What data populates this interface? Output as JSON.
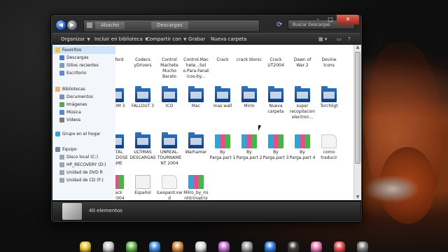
{
  "window": {
    "address_segments": [
      "Abacho",
      "Descargas"
    ],
    "search_placeholder": "Buscar Descargas",
    "controls": {
      "minimize": "–",
      "maximize": "□",
      "close": "✕"
    }
  },
  "toolbar": {
    "organize": "Organizar",
    "include": "Incluir en biblioteca",
    "share": "Compartir con",
    "burn": "Grabar",
    "new_folder": "Nueva carpeta"
  },
  "sidebar": {
    "items": [
      {
        "label": "Favoritos",
        "icon": "star-icon",
        "color": "#f3c43a"
      },
      {
        "label": "Descargas",
        "icon": "downloads-icon",
        "color": "#3c7dd6"
      },
      {
        "label": "Sitios recientes",
        "icon": "recent-icon",
        "color": "#7b9bc6"
      },
      {
        "label": "Escritorio",
        "icon": "desktop-icon",
        "color": "#5b8bd0"
      },
      {
        "label": "Bibliotecas",
        "icon": "library-icon",
        "color": "#e5b755"
      },
      {
        "label": "Documentos",
        "icon": "documents-icon",
        "color": "#7d8fb8"
      },
      {
        "label": "Imágenes",
        "icon": "pictures-icon",
        "color": "#5fa05a"
      },
      {
        "label": "Música",
        "icon": "music-icon",
        "color": "#4a8ad8"
      },
      {
        "label": "Vídeos",
        "icon": "video-icon",
        "color": "#7a7a7a"
      },
      {
        "label": "Grupo en el hogar",
        "icon": "homegroup-icon",
        "color": "#3ba0d9"
      },
      {
        "label": "Equipo",
        "icon": "computer-icon",
        "color": "#6a87b0"
      },
      {
        "label": "Disco local (C:)",
        "icon": "drive-icon",
        "color": "#9aa6b3"
      },
      {
        "label": "HP_RECOVERY (D:)",
        "icon": "drive-icon",
        "color": "#9aa6b3"
      },
      {
        "label": "Unidad de DVD R",
        "icon": "dvd-icon",
        "color": "#9aa6b3"
      },
      {
        "label": "Unidad de CD (F:)",
        "icon": "cd-icon",
        "color": "#9aa6b3"
      }
    ]
  },
  "files": [
    {
      "name": "clifford",
      "type": "folder"
    },
    {
      "name": "Codecs yDrivers",
      "type": "folder"
    },
    {
      "name": "Control Machete Mucho Barato",
      "type": "folder"
    },
    {
      "name": "Control.Machete...Sol o.Para.Fanaticos-by...",
      "type": "folder"
    },
    {
      "name": "Crack",
      "type": "folder"
    },
    {
      "name": "crack blonic",
      "type": "folder"
    },
    {
      "name": "Crack UT2004",
      "type": "folder"
    },
    {
      "name": "Dawn of War 2",
      "type": "folder"
    },
    {
      "name": "Devine Icons",
      "type": "folder"
    },
    {
      "name": "DOOM 3",
      "type": "folder"
    },
    {
      "name": "FALLOUT 3",
      "type": "folder"
    },
    {
      "name": "ICO",
      "type": "folder"
    },
    {
      "name": "Mac",
      "type": "folder"
    },
    {
      "name": "mas wall",
      "type": "folder"
    },
    {
      "name": "Mirro",
      "type": "folder"
    },
    {
      "name": "Nueva carpeta",
      "type": "folder"
    },
    {
      "name": "super recopilacion electron...",
      "type": "folder"
    },
    {
      "name": "Torchligt",
      "type": "folder"
    },
    {
      "name": "TOTAL OVERDOSE GAME",
      "type": "folder"
    },
    {
      "name": "ULTIMAS DESCARGAS",
      "type": "folder"
    },
    {
      "name": "UNREAL-TOURNAMENT 2004",
      "type": "folder"
    },
    {
      "name": "Warhamer",
      "type": "folder"
    },
    {
      "name": "By Parga.part 1",
      "type": "rar"
    },
    {
      "name": "By Parga.part 2",
      "type": "rar"
    },
    {
      "name": "By Parga.part 3",
      "type": "rar"
    },
    {
      "name": "By Parga.part 4",
      "type": "rar"
    },
    {
      "name": "como traducir",
      "type": "gen"
    },
    {
      "name": "Crack UT2004",
      "type": "rar"
    },
    {
      "name": "Español",
      "type": "doc"
    },
    {
      "name": "iLeopard.xwd",
      "type": "gen"
    },
    {
      "name": "Milro_by_minhtrimatrix",
      "type": "rar"
    }
  ],
  "status": {
    "count": "40 elementos"
  }
}
